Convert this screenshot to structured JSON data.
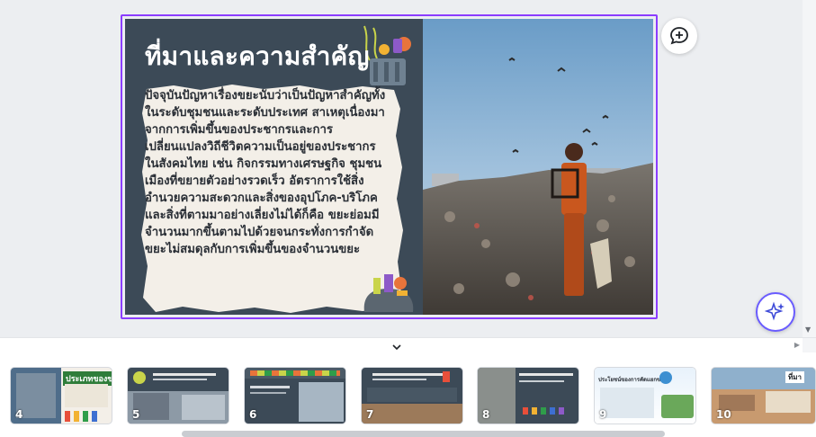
{
  "slide": {
    "title": "ที่มาและความสำคัญ",
    "body": "ปัจจุบันปัญหาเรื่องขยะนับว่าเป็นปัญหาสำคัญทั้งในระดับชุมชนและระดับประเทศ สาเหตุเนื่องมาจากการเพิ่มขึ้นของประชากรและการเปลี่ยนแปลงวิถีชีวิตความเป็นอยู่ของประชากรในสังคมไทย เช่น กิจกรรมทางเศรษฐกิจ ชุมชนเมืองที่ขยายตัวอย่างรวดเร็ว อัตราการใช้สิ่งอำนวยความสะดวกและสิ่งของอุปโภค-บริโภค และสิ่งที่ตามมาอย่างเลี่ยงไม่ได้ก็คือ ขยะย่อมมีจำนวนมากขึ้นตามไปด้วยจนกระทั่งการกำจัดขยะไม่สมดุลกับการเพิ่มขึ้นของจำนวนขยะ",
    "photo_icon": "child-on-landfill-photo"
  },
  "buttons": {
    "comment_icon": "add-comment-icon",
    "magic_icon": "sparkle-icon"
  },
  "thumbnails": [
    {
      "num": "4",
      "heading": "ประเภทของขยะ"
    },
    {
      "num": "5",
      "heading": ""
    },
    {
      "num": "6",
      "heading": ""
    },
    {
      "num": "7",
      "heading": ""
    },
    {
      "num": "8",
      "heading": ""
    },
    {
      "num": "9",
      "heading": "ประโยชน์ของการคัดแยกขยะ"
    },
    {
      "num": "10",
      "heading": "ที่มา"
    }
  ],
  "colors": {
    "selection": "#8b3dff",
    "slide_bg": "#3c4a57",
    "paper": "#f3efe8"
  }
}
